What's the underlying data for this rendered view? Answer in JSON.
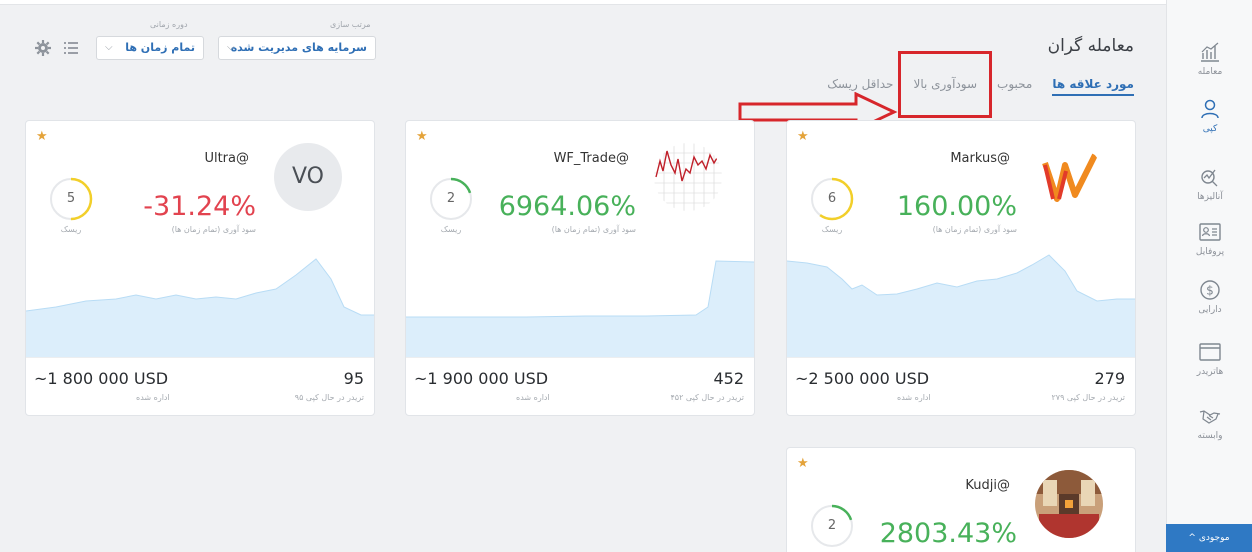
{
  "header": {
    "title": "معامله گران",
    "tabs": [
      "مورد علاقه ها",
      "محبوب",
      "سودآوری بالا",
      "حداقل ریسک"
    ],
    "sort_label": "مرتب سازی",
    "sort_value": "سرمایه های مدیریت شده",
    "period_label": "دوره زمانی",
    "period_value": "تمام زمان ها"
  },
  "sidebar": {
    "items": [
      {
        "label": "معامله",
        "icon": "trade-chart-icon"
      },
      {
        "label": "کپی",
        "icon": "copy-user-icon"
      },
      {
        "label": "آنالیزها",
        "icon": "analysis-icon"
      },
      {
        "label": "پروفایل",
        "icon": "profile-card-icon"
      },
      {
        "label": "دارایی",
        "icon": "dollar-icon"
      },
      {
        "label": "هاتریدر",
        "icon": "window-icon"
      },
      {
        "label": "وابسته",
        "icon": "handshake-icon"
      }
    ],
    "footer": "موجودی"
  },
  "cards": [
    {
      "handle": "Markus@",
      "profit": "160.00%",
      "profit_label": "سود آوری (تمام زمان ها)",
      "risk": "6",
      "risk_label": "ریسک",
      "aum": "~2 500 000 USD",
      "aum_label": "اداره شده",
      "investors": "279",
      "investors_label": "۲۷۹ تریدر در حال کپی",
      "trend": "positive",
      "risk_fraction": 0.6
    },
    {
      "handle": "WF_Trade@",
      "profit": "6964.06%",
      "profit_label": "سود آوری (تمام زمان ها)",
      "risk": "2",
      "risk_label": "ریسک",
      "aum": "~1 900 000 USD",
      "aum_label": "اداره شده",
      "investors": "452",
      "investors_label": "۴۵۲ تریدر در حال کپی",
      "trend": "positive",
      "risk_fraction": 0.2
    },
    {
      "handle": "Ultra@",
      "profit": "-31.24%",
      "profit_label": "سود آوری (تمام زمان ها)",
      "risk": "5",
      "risk_label": "ریسک",
      "aum": "~1 800 000 USD",
      "aum_label": "اداره شده",
      "investors": "95",
      "investors_label": "۹۵ تریدر در حال کپی",
      "avatar_text": "VO",
      "trend": "negative",
      "risk_fraction": 0.5
    },
    {
      "handle": "Kudji@",
      "profit": "2803.43%",
      "risk": "2",
      "trend": "positive",
      "risk_fraction": 0.2
    }
  ],
  "colors": {
    "accent": "#2f6fb5",
    "positive": "#48b15a",
    "negative": "#e2434f",
    "star": "#e4a33a",
    "annotation": "#d7262b"
  }
}
